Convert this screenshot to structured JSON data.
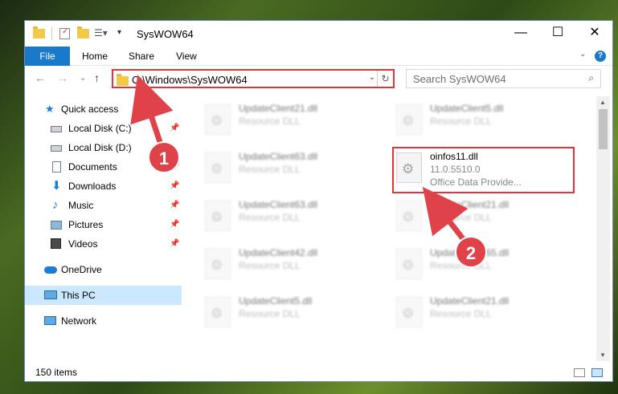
{
  "window": {
    "title": "SysWOW64",
    "minimize": "—",
    "maximize": "☐",
    "close": "✕"
  },
  "ribbon": {
    "tabs": [
      "File",
      "Home",
      "Share",
      "View"
    ],
    "expand": "⌄",
    "help": "?"
  },
  "address": {
    "path": "C:\\Windows\\SysWOW64",
    "back": "←",
    "forward": "→",
    "recent": "⌄",
    "up": "↑",
    "dropdown": "⌄",
    "refresh": "↻"
  },
  "search": {
    "placeholder": "Search SysWOW64",
    "icon": "⌕"
  },
  "nav": {
    "items": [
      {
        "label": "Quick access",
        "icon": "star-icon",
        "pinned": false
      },
      {
        "label": "Local Disk (C:)",
        "icon": "drive-icon",
        "pinned": true
      },
      {
        "label": "Local Disk (D:)",
        "icon": "drive-icon",
        "pinned": false
      },
      {
        "label": "Documents",
        "icon": "document-icon",
        "pinned": true
      },
      {
        "label": "Downloads",
        "icon": "download-icon",
        "pinned": true
      },
      {
        "label": "Music",
        "icon": "music-icon",
        "pinned": true
      },
      {
        "label": "Pictures",
        "icon": "picture-icon",
        "pinned": true
      },
      {
        "label": "Videos",
        "icon": "video-icon",
        "pinned": true
      },
      {
        "label": "OneDrive",
        "icon": "cloud-icon",
        "pinned": false
      },
      {
        "label": "This PC",
        "icon": "computer-icon",
        "pinned": false
      },
      {
        "label": "Network",
        "icon": "network-icon",
        "pinned": false
      }
    ],
    "pin_glyph": "📌"
  },
  "files": [
    {
      "name": "UpdateClient21.dll",
      "type": "Resource DLL"
    },
    {
      "name": "UpdateClient5.dll",
      "type": "Resource DLL"
    },
    {
      "name": "UpdateClient63.dll",
      "type": "Resource DLL"
    },
    {
      "name": "oinfos11.dll",
      "version": "11.0.5510.0",
      "type": "Office Data Provide..."
    },
    {
      "name": "UpdateClient63.dll",
      "type": "Resource DLL"
    },
    {
      "name": "UpdateClient21.dll",
      "type": "Resource DLL"
    },
    {
      "name": "UpdateClient42.dll",
      "type": "Resource DLL"
    },
    {
      "name": "UpdateClient65.dll",
      "type": "Resource DLL"
    },
    {
      "name": "UpdateClient5.dll",
      "type": "Resource DLL"
    },
    {
      "name": "UpdateClient21.dll",
      "type": "Resource DLL"
    }
  ],
  "status": {
    "count": "150 items"
  },
  "annotations": {
    "step1": "1",
    "step2": "2",
    "accent": "#e0424a"
  }
}
